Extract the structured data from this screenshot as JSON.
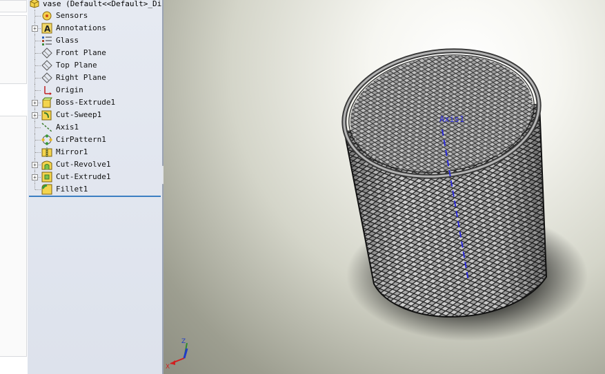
{
  "tree": {
    "root_label": "vase  (Default<<Default>_Disp",
    "items": [
      {
        "label": "Sensors",
        "icon": "sensor-icon",
        "expandable": false
      },
      {
        "label": "Annotations",
        "icon": "annotations-icon",
        "expandable": true
      },
      {
        "label": "Glass",
        "icon": "material-icon",
        "expandable": false
      },
      {
        "label": "Front Plane",
        "icon": "plane-icon",
        "expandable": false
      },
      {
        "label": "Top Plane",
        "icon": "plane-icon",
        "expandable": false
      },
      {
        "label": "Right Plane",
        "icon": "plane-icon",
        "expandable": false
      },
      {
        "label": "Origin",
        "icon": "origin-icon",
        "expandable": false
      },
      {
        "label": "Boss-Extrude1",
        "icon": "boss-extrude-icon",
        "expandable": true
      },
      {
        "label": "Cut-Sweep1",
        "icon": "cut-sweep-icon",
        "expandable": true
      },
      {
        "label": "Axis1",
        "icon": "axis-icon",
        "expandable": false
      },
      {
        "label": "CirPattern1",
        "icon": "circular-pattern-icon",
        "expandable": false
      },
      {
        "label": "Mirror1",
        "icon": "mirror-icon",
        "expandable": false
      },
      {
        "label": "Cut-Revolve1",
        "icon": "cut-revolve-icon",
        "expandable": true
      },
      {
        "label": "Cut-Extrude1",
        "icon": "cut-extrude-icon",
        "expandable": true
      },
      {
        "label": "Fillet1",
        "icon": "fillet-icon",
        "expandable": false
      }
    ]
  },
  "viewport": {
    "axis_label": "Axis1",
    "triad": {
      "x": "X",
      "z": "Z"
    }
  },
  "colors": {
    "accent": "#3a7ec2",
    "axis_line": "#2a2ad8",
    "panel_bg": "#e1e6ef"
  }
}
